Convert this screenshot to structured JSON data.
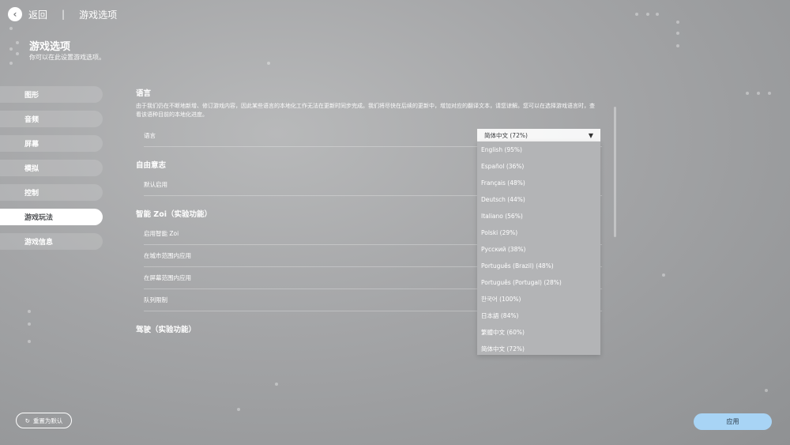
{
  "header": {
    "back_label": "返回",
    "separator": "|",
    "breadcrumb": "游戏选项"
  },
  "page": {
    "title": "游戏选项",
    "subtitle": "你可以在此设置游戏选项。"
  },
  "sidebar": {
    "items": [
      {
        "label": "图形"
      },
      {
        "label": "音频"
      },
      {
        "label": "屏幕"
      },
      {
        "label": "模拟"
      },
      {
        "label": "控制"
      },
      {
        "label": "游戏玩法"
      },
      {
        "label": "游戏信息"
      }
    ],
    "active_index": 5
  },
  "sections": {
    "language": {
      "title": "语言",
      "description": "由于我们仍在不断地新增、修订游戏内容，因此某些语言的本地化工作无法在更新时同步完成。我们将尽快在后续的更新中，增加对应的翻译文本，请您谅解。您可以在选择游戏语言时，查看该语种目前的本地化进度。",
      "row_label": "语言"
    },
    "free_will": {
      "title": "自由意志",
      "row_label": "默认启用"
    },
    "smart_zoi": {
      "title": "智能 Zoi（实验功能）",
      "rows": [
        "启用智能 Zoi",
        "在城市范围内应用",
        "在屏幕范围内应用",
        "队列限制"
      ]
    },
    "driving": {
      "title": "驾驶（实验功能）"
    }
  },
  "dropdown": {
    "selected": "简体中文 (72%)",
    "arrow": "▼",
    "options": [
      "English (95%)",
      "Español (36%)",
      "Français (48%)",
      "Deutsch (44%)",
      "Italiano (56%)",
      "Polski (29%)",
      "Русский (38%)",
      "Português (Brazil) (48%)",
      "Português (Portugal) (28%)",
      "한국어 (100%)",
      "日本語 (84%)",
      "繁體中文 (60%)",
      "简体中文 (72%)"
    ]
  },
  "footer": {
    "reset_icon": "↻",
    "reset_label": "重置为默认",
    "apply_label": "应用"
  },
  "colors": {
    "accent_button": "#a8d4f5",
    "active_tab_bg": "#ffffff"
  }
}
